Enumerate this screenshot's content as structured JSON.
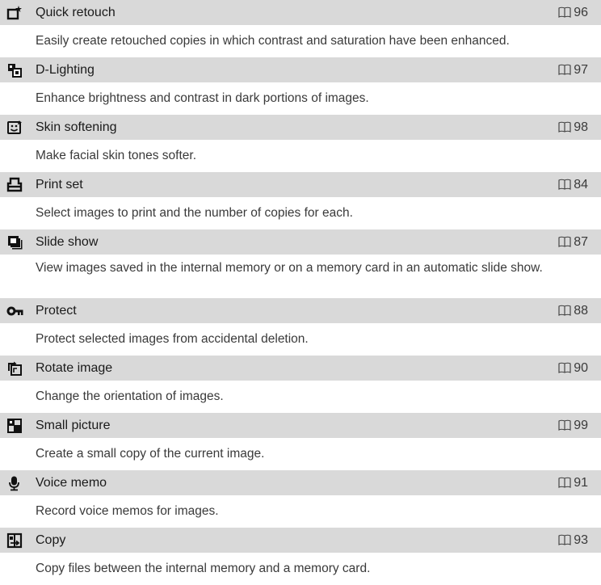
{
  "items": [
    {
      "title": "Quick retouch",
      "page": "96",
      "icon": "quick-retouch-icon",
      "description": "Easily create retouched copies in which contrast and saturation have been enhanced."
    },
    {
      "title": "D-Lighting",
      "page": "97",
      "icon": "d-lighting-icon",
      "description": "Enhance brightness and contrast in dark portions of images."
    },
    {
      "title": "Skin softening",
      "page": "98",
      "icon": "skin-softening-icon",
      "description": "Make facial skin tones softer."
    },
    {
      "title": "Print set",
      "page": "84",
      "icon": "printer-icon",
      "description": "Select images to print and the number of copies for each."
    },
    {
      "title": "Slide show",
      "page": "87",
      "icon": "slide-show-icon",
      "description": "View images saved in the internal memory or on a memory card in an automatic slide show."
    },
    {
      "title": "Protect",
      "page": "88",
      "icon": "key-icon",
      "description": "Protect selected images from accidental deletion."
    },
    {
      "title": "Rotate image",
      "page": "90",
      "icon": "rotate-image-icon",
      "description": "Change the orientation of images."
    },
    {
      "title": "Small picture",
      "page": "99",
      "icon": "small-picture-icon",
      "description": "Create a small copy of the current image."
    },
    {
      "title": "Voice memo",
      "page": "91",
      "icon": "microphone-icon",
      "description": "Record voice memos for images."
    },
    {
      "title": "Copy",
      "page": "93",
      "icon": "copy-icon",
      "description": "Copy files between the internal memory and a memory card."
    }
  ]
}
